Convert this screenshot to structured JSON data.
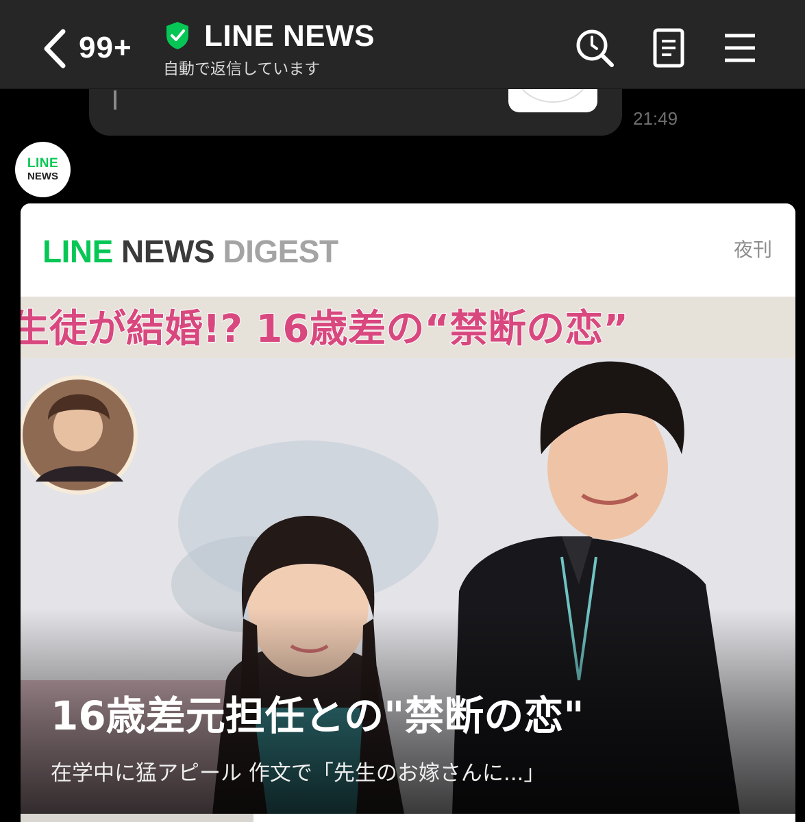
{
  "header": {
    "unread_count": "99+",
    "channel_name": "LINE NEWS",
    "status": "自動で返信しています"
  },
  "previous_message": {
    "time": "21:49"
  },
  "avatar": {
    "line": "LINE",
    "news": "NEWS"
  },
  "card": {
    "brand_line": "LINE",
    "brand_news": " NEWS",
    "brand_digest": " DIGEST",
    "edition": "夜刊",
    "hero": {
      "banner_text": "生徒が結婚!? 16歳差の“禁断の恋”",
      "headline": "16歳差元担任との\"禁断の恋\"",
      "subheadline": "在学中に猛アピール 作文で「先生のお嫁さんに...」"
    }
  },
  "colors": {
    "line_green": "#06c755",
    "header_bg": "#262626",
    "page_bg": "#000000",
    "verified_green": "#06c755"
  }
}
